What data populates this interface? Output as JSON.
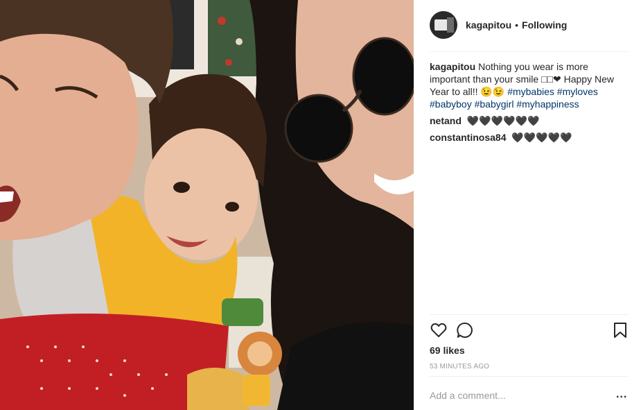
{
  "post": {
    "username": "kagapitou",
    "separator": "•",
    "follow_label": "Following",
    "caption": {
      "user": "kagapitou",
      "text": "Nothing you wear is more important than your smile ",
      "emoji_boxes": "□□❤",
      "text2": " Happy New Year to all!! ",
      "emoji_faces": "😉😉",
      "hashtags": [
        "#mybabies",
        "#myloves",
        "#babyboy",
        "#babygirl",
        "#myhappiness"
      ]
    },
    "comments": [
      {
        "user": "netand",
        "text": "🖤🖤🖤🖤🖤🖤"
      },
      {
        "user": "constantinosa84",
        "text": "🖤🖤🖤🖤🖤"
      }
    ],
    "likes": "69 likes",
    "timestamp": "53 MINUTES AGO",
    "comment_placeholder": "Add a comment...",
    "more_label": "..."
  },
  "icons": {
    "like": "heart-outline-icon",
    "comment": "comment-bubble-icon",
    "save": "bookmark-icon",
    "more": "more-options-icon"
  },
  "colors": {
    "hashtag": "#003569",
    "text": "#262626",
    "muted": "#999999",
    "divider": "#efefef"
  }
}
